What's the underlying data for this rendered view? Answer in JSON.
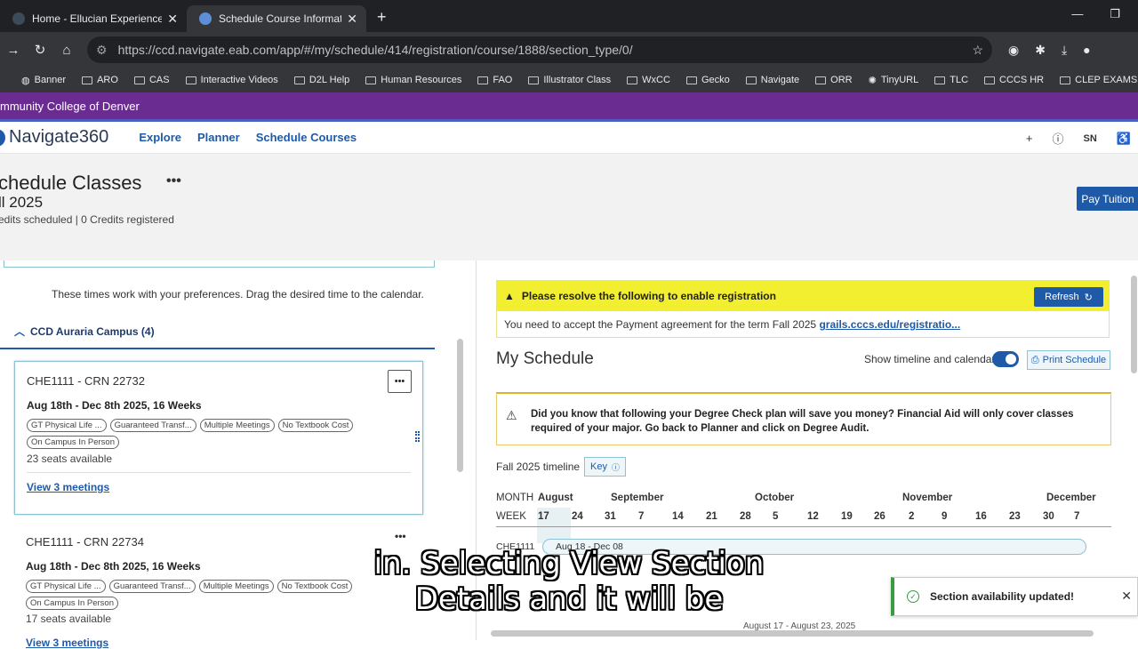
{
  "browser": {
    "tabs": [
      {
        "title": "Home - Ellucian Experience",
        "close": "✕"
      },
      {
        "title": "Schedule Course Information | N",
        "close": "✕"
      }
    ],
    "new_tab": "+",
    "window_controls": [
      "—",
      "❐"
    ],
    "url": "https://ccd.navigate.eab.com/app/#/my/schedule/414/registration/course/1888/section_type/0/",
    "bookmarks": [
      "Banner",
      "ARO",
      "CAS",
      "Interactive Videos",
      "D2L Help",
      "Human Resources",
      "FAO",
      "Illustrator Class",
      "WxCC",
      "Gecko",
      "Navigate",
      "ORR",
      "TinyURL",
      "TLC",
      "CCCS HR",
      "CLEP EXAMS"
    ]
  },
  "site": {
    "banner": "mmunity College of Denver",
    "brand": "Navigate360",
    "nav": [
      "Explore",
      "Planner",
      "Schedule Courses"
    ],
    "user_initials": "SN"
  },
  "header": {
    "title": "chedule Classes",
    "menu": "•••",
    "term": "ll 2025",
    "credits": "edits scheduled | 0 Credits registered",
    "pay_button": "Pay Tuition"
  },
  "left": {
    "preference_note": "These times work with your preferences. Drag the desired time to the calendar.",
    "campus": "CCD Auraria Campus (4)",
    "sections": [
      {
        "crn": "CHE1111 - CRN 22732",
        "dates": "Aug 18th - Dec 8th 2025, 16 Weeks",
        "tags": [
          "GT Physical Life ...",
          "Guaranteed Transf...",
          "Multiple Meetings",
          "No Textbook Cost",
          "On Campus In Person"
        ],
        "seats": "23 seats available",
        "meetings_link": "View 3 meetings",
        "more": "•••"
      },
      {
        "crn": "CHE1111 - CRN 22734",
        "dates": "Aug 18th - Dec 8th 2025, 16 Weeks",
        "tags": [
          "GT Physical Life ...",
          "Guaranteed Transf...",
          "Multiple Meetings",
          "No Textbook Cost",
          "On Campus In Person"
        ],
        "seats": "17 seats available",
        "meetings_link": "View 3 meetings",
        "more": "•••"
      }
    ]
  },
  "right": {
    "alert_title": "Please resolve the following to enable registration",
    "refresh_button": "Refresh",
    "alert_body": "You need to accept the Payment agreement for the term Fall 2025 ",
    "alert_link": "grails.cccs.edu/registratio...",
    "my_schedule": "My Schedule",
    "toggle_label": "Show timeline and calendar",
    "print_button": "Print Schedule",
    "info_text": "Did you know that following your Degree Check plan will save you money? Financial Aid will only cover classes required of your major. Go back to Planner and click on Degree Audit.",
    "timeline_label": "Fall 2025 timeline",
    "key_button": "Key",
    "month_label": "MONTH",
    "week_label": "WEEK",
    "months": [
      "August",
      "September",
      "October",
      "November",
      "December"
    ],
    "weeks": [
      "17",
      "24",
      "31",
      "7",
      "14",
      "21",
      "28",
      "5",
      "12",
      "19",
      "26",
      "2",
      "9",
      "16",
      "23",
      "30",
      "7"
    ],
    "course_label": "CHE1111",
    "course_bar": "Aug 18 - Dec 08",
    "week_range": "August 17 - August 23, 2025"
  },
  "toast": {
    "text": "Section availability updated!",
    "close": "✕"
  },
  "caption": {
    "line1": "in. Selecting View Section",
    "line2": "Details and it will be"
  },
  "colors": {
    "brand_purple": "#6a2c91",
    "primary_blue": "#1e5aa8",
    "alert_yellow": "#f2ee30",
    "success_green": "#3c9a42"
  }
}
